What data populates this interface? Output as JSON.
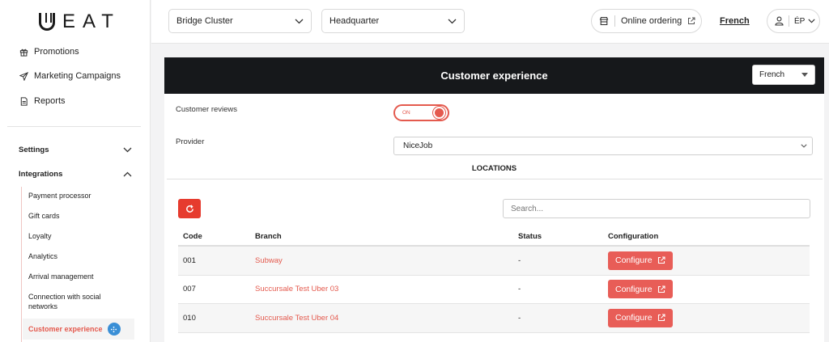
{
  "brand": {
    "logo_text": "EAT"
  },
  "sidebar": {
    "items": [
      {
        "label": "Promotions",
        "icon": "gift-icon"
      },
      {
        "label": "Marketing Campaigns",
        "icon": "send-icon"
      },
      {
        "label": "Reports",
        "icon": "document-icon"
      }
    ],
    "settings_label": "Settings",
    "integrations_label": "Integrations",
    "integrations_items": [
      "Payment processor",
      "Gift cards",
      "Loyalty",
      "Analytics",
      "Arrival management",
      "Connection with social networks",
      "Customer experience"
    ]
  },
  "topbar": {
    "cluster_select": "Bridge Cluster",
    "location_select": "Headquarter",
    "online_ordering": "Online ordering",
    "language": "French",
    "user_initials": "ÉP"
  },
  "panel": {
    "title": "Customer experience",
    "language_select": "French",
    "reviews_label": "Customer reviews",
    "toggle_label": "ON",
    "provider_label": "Provider",
    "provider_value": "NiceJob",
    "locations_title": "LOCATIONS",
    "search_placeholder": "Search..."
  },
  "table": {
    "headers": {
      "code": "Code",
      "branch": "Branch",
      "status": "Status",
      "configuration": "Configuration"
    },
    "rows": [
      {
        "code": "001",
        "branch": "Subway",
        "status": "-",
        "action": "Configure"
      },
      {
        "code": "007",
        "branch": "Succursale Test Uber 03",
        "status": "-",
        "action": "Configure"
      },
      {
        "code": "010",
        "branch": "Succursale Test Uber 04",
        "status": "-",
        "action": "Configure"
      }
    ]
  },
  "colors": {
    "accent": "#e45a4e",
    "button_red": "#e63b2e",
    "header_dark": "#16181b",
    "badge_blue": "#3a8fd6"
  }
}
